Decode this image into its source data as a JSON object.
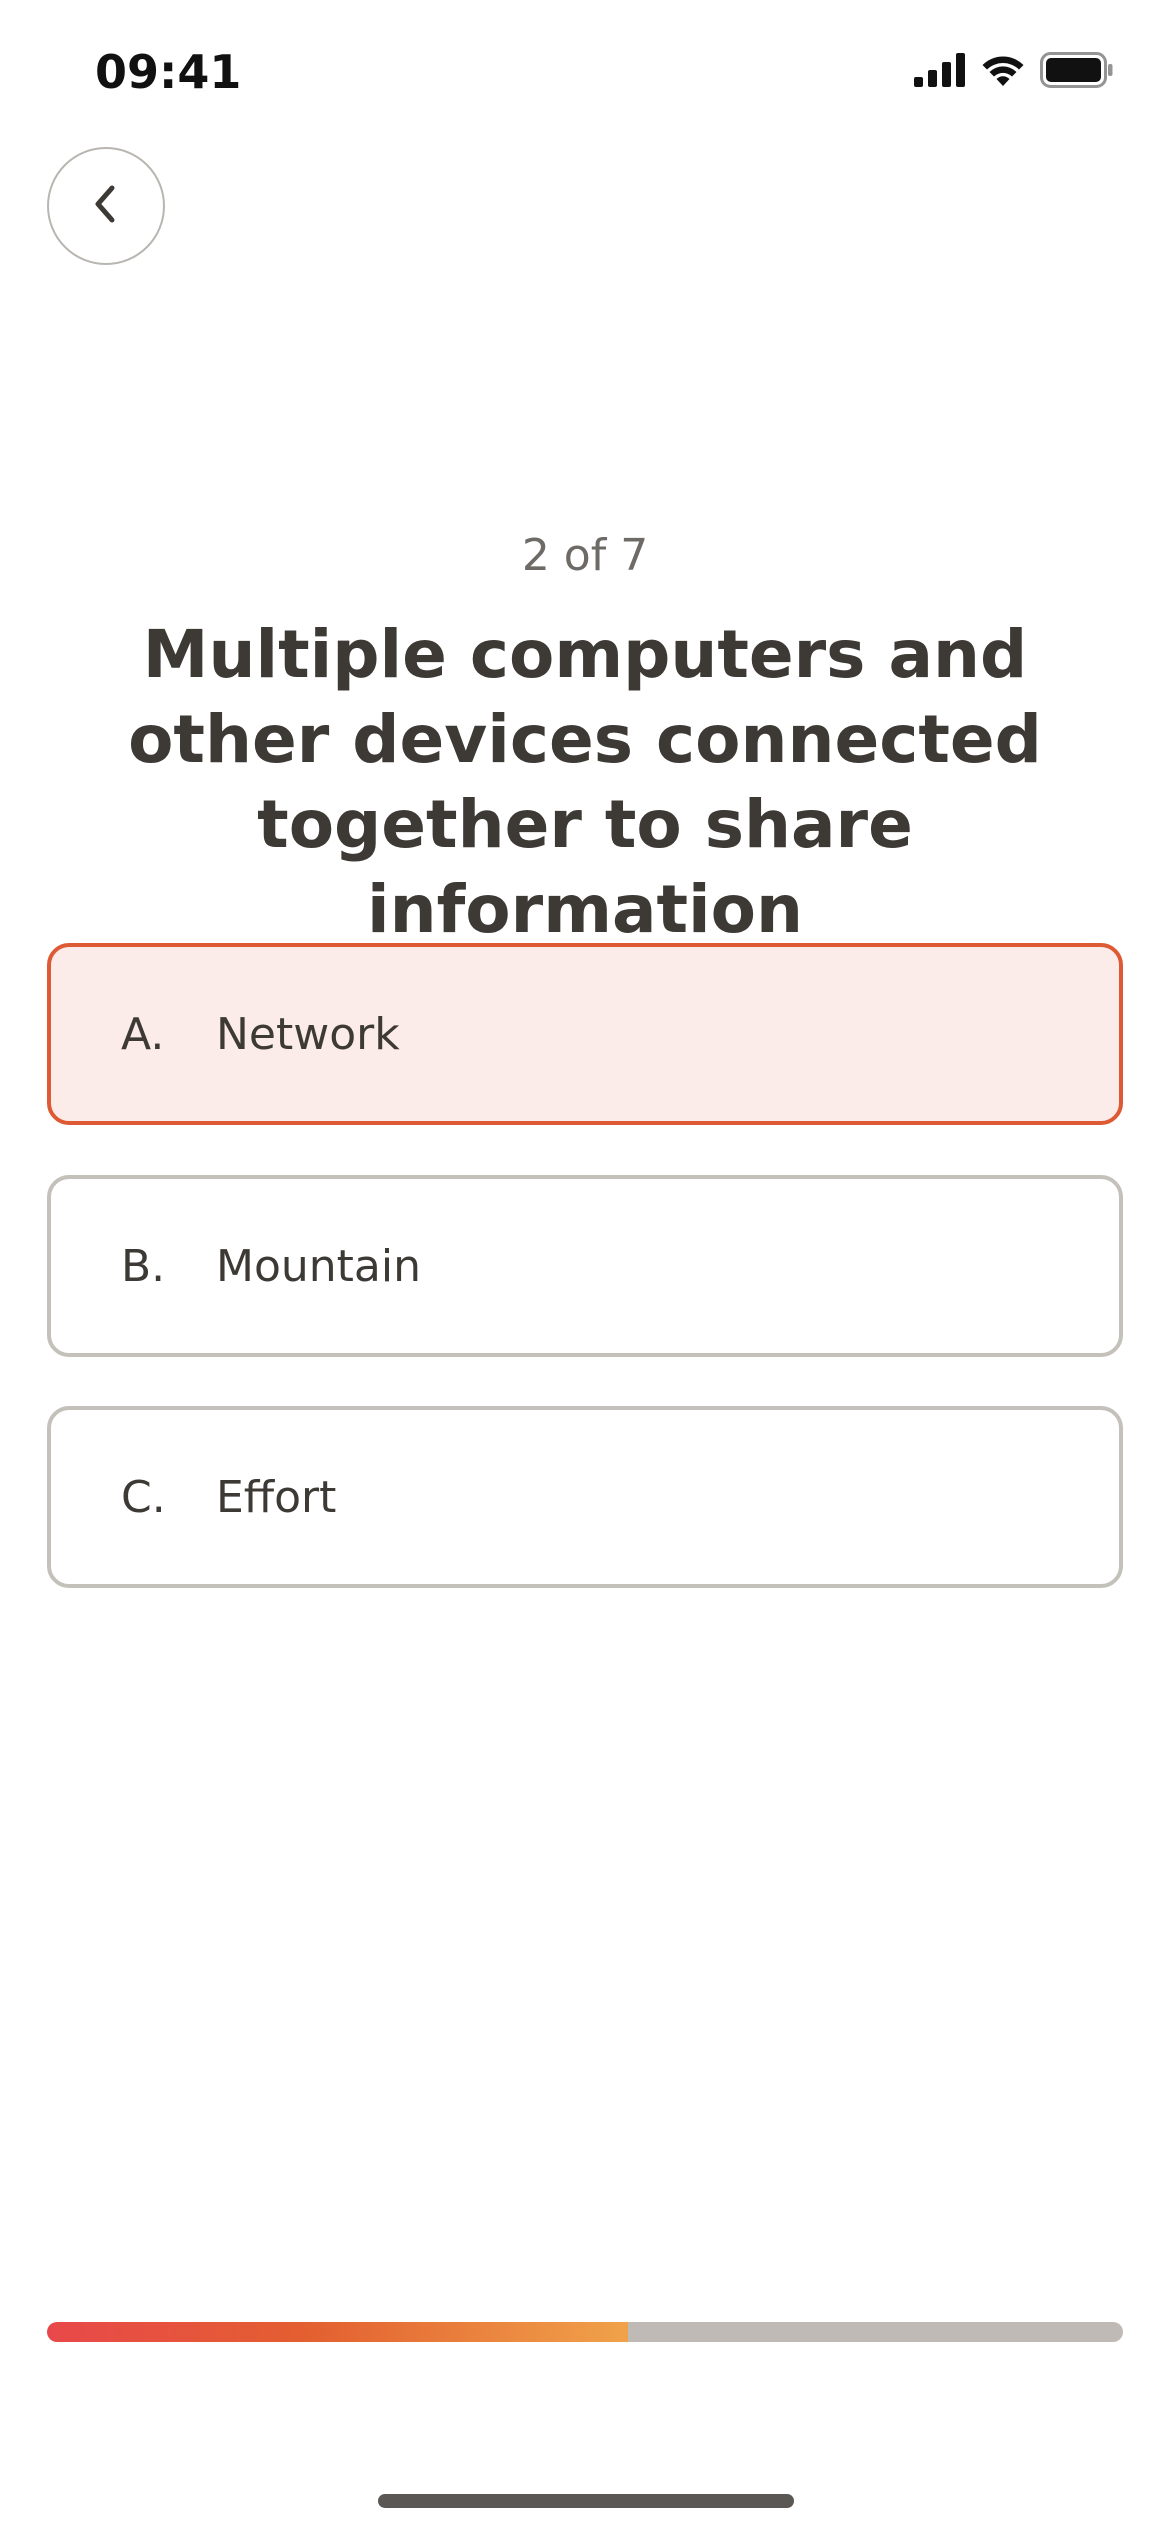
{
  "status_bar": {
    "time": "09:41",
    "icons": [
      "cellular-signal-icon",
      "wifi-icon",
      "battery-icon"
    ]
  },
  "nav": {
    "back_icon": "chevron-left-icon"
  },
  "quiz": {
    "progress_label": "2 of 7",
    "question": "Multiple computers and other devices connected together to share information",
    "options": [
      {
        "letter": "A.",
        "label": "Network",
        "selected": true
      },
      {
        "letter": "B.",
        "label": "Mountain",
        "selected": false
      },
      {
        "letter": "C.",
        "label": "Effort",
        "selected": false
      }
    ],
    "progress_fraction": 0.54
  },
  "colors": {
    "accent": "#dd5a35",
    "selected_background": "#fbecea",
    "progress_start": "#e8484a",
    "progress_end": "#f0a24a",
    "progress_track": "#bfbab5"
  }
}
